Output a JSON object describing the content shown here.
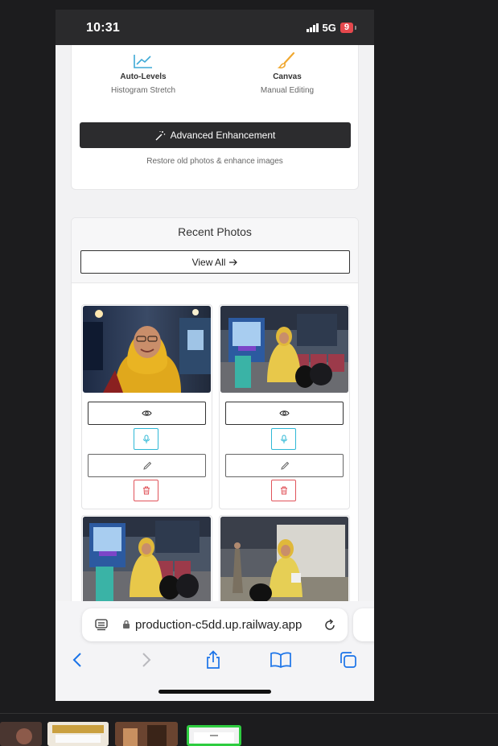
{
  "status_bar": {
    "time": "10:31",
    "network": "5G",
    "battery": "9"
  },
  "tools": [
    {
      "title": "Auto-Levels",
      "subtitle": "Histogram Stretch",
      "icon": "chart-line-icon"
    },
    {
      "title": "Canvas",
      "subtitle": "Manual Editing",
      "icon": "brush-icon"
    }
  ],
  "advanced": {
    "label": "Advanced Enhancement",
    "caption": "Restore old photos & enhance images",
    "icon": "magic-wand-icon"
  },
  "recent": {
    "title": "Recent Photos",
    "view_all_label": "View All",
    "view_all_icon": "arrow-right-icon"
  },
  "photos": [
    {
      "description_icon": "photo-woman-yellow-hijab"
    },
    {
      "description_icon": "photo-station-seated"
    },
    {
      "description_icon": "photo-station-seated"
    },
    {
      "description_icon": "photo-station-crossed-legs"
    }
  ],
  "photo_actions": [
    "eye-icon",
    "microphone-icon",
    "pencil-icon",
    "trash-icon"
  ],
  "browser": {
    "url": "production-c5dd.up.railway.app"
  },
  "colors": {
    "accent_dark": "#2c2c2e",
    "mic_cyan": "#2fb8d6",
    "delete_red": "#e0535a",
    "tool_icon_blue": "#3ea9d6",
    "tool_icon_orange": "#f0a830",
    "browser_blue": "#1a73e8"
  }
}
